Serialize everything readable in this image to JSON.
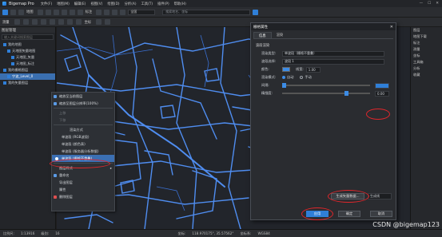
{
  "app": {
    "name": "Bigemap Pro"
  },
  "menu": [
    "文件(F)",
    "地图(M)",
    "编辑(E)",
    "视图(V)",
    "绘图(D)",
    "分析(A)",
    "工具(T)",
    "插件(P)",
    "帮助(H)"
  ],
  "toolbar": {
    "labels": [
      "地图",
      "标注",
      "测量",
      "坐标"
    ],
    "search_placeholder": "搜索地名、坐标",
    "place_select": "全国"
  },
  "left_panel": {
    "title": "图层管理",
    "search_placeholder": "输入关键词搜索图层",
    "tree": [
      {
        "label": "我的地图",
        "checked": true,
        "indent": 1
      },
      {
        "label": "天地图矢量地图",
        "checked": true,
        "indent": 2
      },
      {
        "label": "天地图_矢量",
        "checked": true,
        "indent": 3
      },
      {
        "label": "天地图_标注",
        "checked": true,
        "indent": 3
      },
      {
        "label": "我的栅格图层",
        "checked": true,
        "indent": 1
      },
      {
        "label": "宁波_Level_0",
        "checked": true,
        "indent": 2,
        "selected": true
      },
      {
        "label": "我的矢量图层",
        "checked": true,
        "indent": 1
      }
    ]
  },
  "context_menu": {
    "items": [
      {
        "label": "缩放至当前图层",
        "disabled": false,
        "icon": "zoom-layer-icon"
      },
      {
        "label": "缩放至图层分辨率(100%)",
        "disabled": false,
        "icon": "resolution-icon"
      },
      {
        "label": "上移",
        "disabled": true
      },
      {
        "label": "下移",
        "disabled": true
      },
      {
        "label": "渲染方式",
        "disabled": false,
        "header": true
      },
      {
        "label": "单波段 (RGB波段)",
        "disabled": false
      },
      {
        "label": "单波段 (颜色表)",
        "disabled": false
      },
      {
        "label": "单波段 (服务器分析数据)",
        "disabled": false
      },
      {
        "label": "单波段 (栅格不重叠)",
        "disabled": false,
        "highlight": true
      },
      {
        "label": "图层样式",
        "disabled": false
      },
      {
        "label": "重命名",
        "disabled": false
      },
      {
        "label": "导出图层",
        "disabled": false
      },
      {
        "label": "属性",
        "disabled": false
      },
      {
        "label": "删除图层",
        "disabled": false
      }
    ]
  },
  "dialog": {
    "title": "栅格属性",
    "tabs": [
      "信息",
      "渲染"
    ],
    "active_tab": "信息",
    "section": "波段渲染",
    "render_type_label": "渲染类型:",
    "render_type_value": "单波段（栅格不重叠）",
    "band_label": "波段选择:",
    "band_value": "波段 1",
    "color_label": "颜色:",
    "linewidth_label": "线宽:",
    "linewidth_value": "1.00",
    "mode_label": "渲染模式:",
    "mode_options": [
      "自动",
      "手动"
    ],
    "mode_selected": "自动",
    "interval_label": "间隔:",
    "interval_value": "",
    "smooth_label": "精细度:",
    "smooth_value": "0.00",
    "smooth_fill": 0.74,
    "generate_button": "生成矢量数据...",
    "export_select": "生成线",
    "apply_button": "应用",
    "ok_button": "确定",
    "cancel_button": "取消",
    "color_hex": "#3c8ce6"
  },
  "right_panel": {
    "items": [
      "图层",
      "地图下载",
      "标注",
      "测量",
      "坐标",
      "工具箱",
      "分析",
      "收藏"
    ]
  },
  "status_bar": {
    "scale_label": "比例尺:",
    "scale_value": "1:13916",
    "level_label": "级别:",
    "level_value": "16",
    "coord_label": "坐标:",
    "coord_value": "118.970175°, 35.57562°",
    "system_label": "坐标系:",
    "system_value": "WGS84"
  },
  "watermark": "CSDN @bigemap123",
  "colors": {
    "accent": "#2f7fd8",
    "highlight": "#e0262b",
    "road": "#4f8df0"
  }
}
